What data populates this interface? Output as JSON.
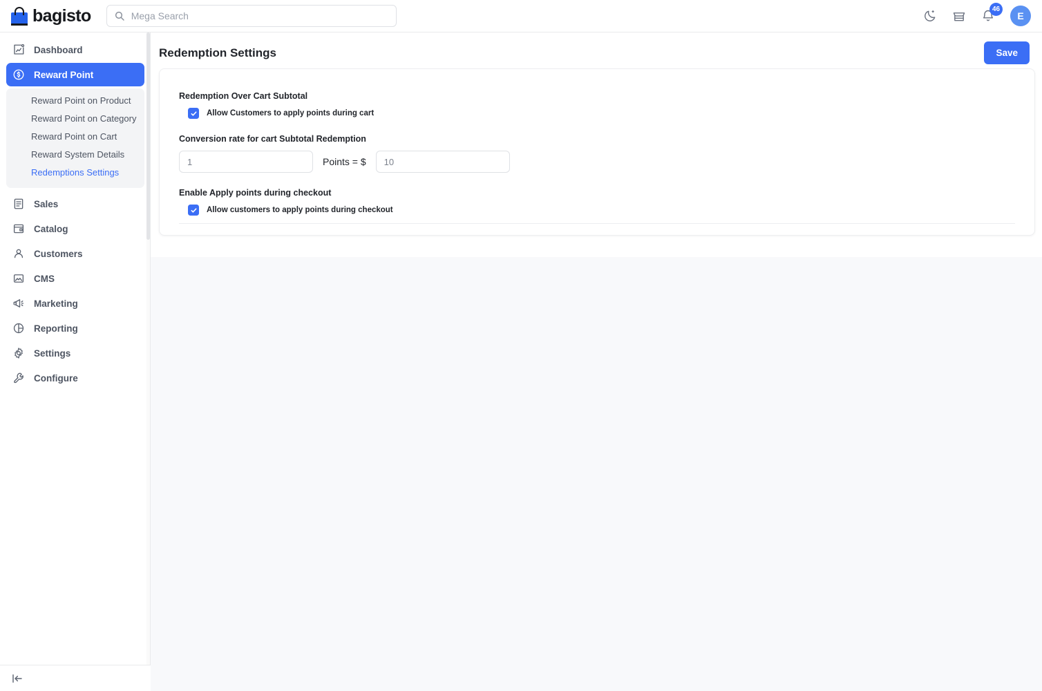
{
  "header": {
    "logo_text": "bagisto",
    "logo_icon": "shopping-bag-icon",
    "search_placeholder": "Mega Search",
    "search_value": "",
    "search_icon": "search-icon",
    "dark_mode_icon": "moon-icon",
    "store_icon": "store-icon",
    "notification_icon": "bell-icon",
    "notification_count": "46",
    "avatar_initial": "E"
  },
  "sidebar": {
    "items": [
      {
        "label": "Dashboard",
        "icon": "dashboard-chart-icon",
        "active": false
      },
      {
        "label": "Reward Point",
        "icon": "reward-coin-icon",
        "active": true
      },
      {
        "label": "Sales",
        "icon": "document-lines-icon",
        "active": false
      },
      {
        "label": "Catalog",
        "icon": "catalog-window-icon",
        "active": false
      },
      {
        "label": "Customers",
        "icon": "person-icon",
        "active": false
      },
      {
        "label": "CMS",
        "icon": "image-icon",
        "active": false
      },
      {
        "label": "Marketing",
        "icon": "megaphone-icon",
        "active": false
      },
      {
        "label": "Reporting",
        "icon": "pie-chart-icon",
        "active": false
      },
      {
        "label": "Settings",
        "icon": "gear-icon",
        "active": false
      },
      {
        "label": "Configure",
        "icon": "wrench-icon",
        "active": false
      }
    ],
    "submenu": [
      {
        "label": "Reward Point on Product",
        "current": false
      },
      {
        "label": "Reward Point on Category",
        "current": false
      },
      {
        "label": "Reward Point on Cart",
        "current": false
      },
      {
        "label": "Reward System Details",
        "current": false
      },
      {
        "label": "Redemptions Settings",
        "current": true
      }
    ],
    "collapse_icon": "collapse-sidebar-icon"
  },
  "main": {
    "page_title": "Redemption Settings",
    "save_label": "Save",
    "sections": {
      "cart_subtotal": {
        "label": "Redemption Over Cart Subtotal",
        "checkbox_label": "Allow Customers to apply points during cart",
        "checked": true
      },
      "conversion": {
        "label": "Conversion rate for cart Subtotal Redemption",
        "points_value": "1",
        "points_placeholder": "1",
        "middle_label": "Points = $",
        "amount_value": "10",
        "amount_placeholder": "10"
      },
      "checkout": {
        "label": "Enable Apply points during checkout",
        "checkbox_label": "Allow customers to apply points during checkout",
        "checked": true
      }
    }
  },
  "colors": {
    "accent": "#3b6ef5",
    "page_bg": "#f8f9fb",
    "text": "#22252b"
  }
}
